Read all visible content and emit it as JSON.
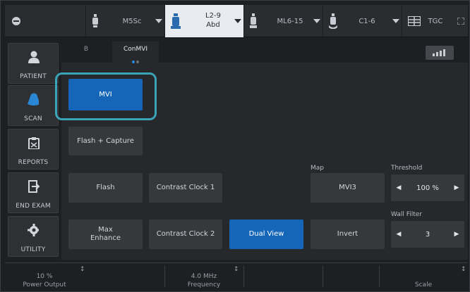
{
  "topbar": {
    "probes": [
      {
        "label": "M5Sc"
      },
      {
        "label": "L2-9\nAbd",
        "line1": "L2-9",
        "line2": "Abd"
      },
      {
        "label": "ML6-15"
      },
      {
        "label": "C1-6"
      },
      {
        "label": "TGC"
      }
    ]
  },
  "nav": {
    "items": [
      {
        "label": "PATIENT",
        "icon": "patient-icon"
      },
      {
        "label": "SCAN",
        "icon": "probe-icon"
      },
      {
        "label": "REPORTS",
        "icon": "clipboard-icon"
      },
      {
        "label": "END EXAM",
        "icon": "exit-icon"
      },
      {
        "label": "UTILITY",
        "icon": "gear-icon"
      }
    ]
  },
  "tabs": {
    "items": [
      {
        "label": "B"
      },
      {
        "label": "ConMVI"
      }
    ]
  },
  "controls": {
    "mvi": "MVI",
    "flash_capture": "Flash + Capture",
    "flash": "Flash",
    "contrast_clock_1": "Contrast Clock 1",
    "max_enhance_1": "Max",
    "max_enhance_2": "Enhance",
    "contrast_clock_2": "Contrast Clock 2",
    "dual_view": "Dual View",
    "map_label": "Map",
    "map_value": "MVI3",
    "invert": "Invert",
    "threshold_label": "Threshold",
    "threshold_value": "100 %",
    "wall_filter_label": "Wall Filter",
    "wall_filter_value": "3"
  },
  "bottom": {
    "power_value": "10 %",
    "power_label": "Power Output",
    "freq_value": "4.0 MHz",
    "freq_label": "Frequency",
    "scale_label": "Scale"
  },
  "colors": {
    "accent_blue": "#1566b8",
    "highlight": "#3aa3b6"
  }
}
